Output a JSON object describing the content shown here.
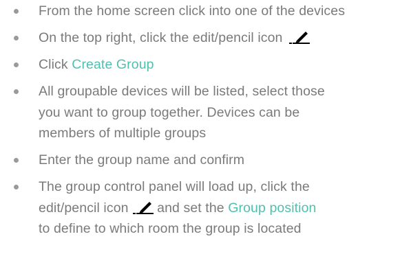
{
  "instructions": {
    "step1": "From the home screen click into one of the devices",
    "step2": "On the top right, click the edit/pencil icon",
    "step3_prefix": "Click ",
    "step3_link": "Create Group",
    "step4_line1": "All groupable devices will be listed, select those",
    "step4_line2": "you want to group together. Devices can be",
    "step4_line3": "members of multiple groups",
    "step5": "Enter the group name and confirm",
    "step6_line1": "The group control panel will load up, click the",
    "step6_line2_a": "edit/pencil icon",
    "step6_line2_b": " and set the ",
    "step6_line2_link": "Group position",
    "step6_line3": "to define to which room the group is located"
  },
  "colors": {
    "text": "#7a7a7a",
    "highlight": "#4fc0b0",
    "icon": "#000000"
  }
}
